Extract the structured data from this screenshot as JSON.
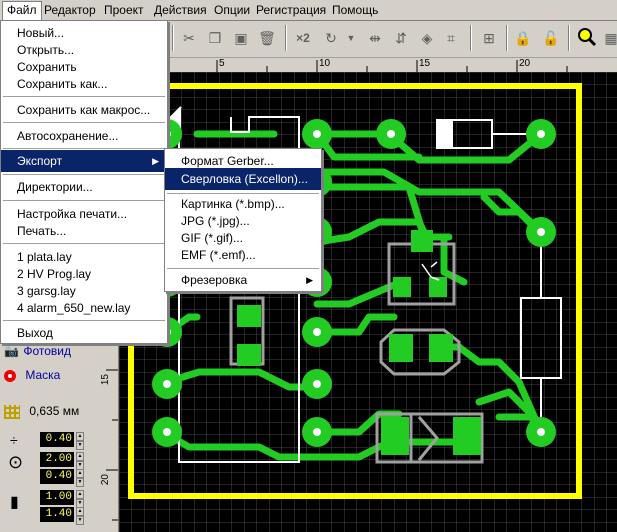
{
  "menubar": {
    "items": [
      {
        "label": "Файл"
      },
      {
        "label": "Редактор"
      },
      {
        "label": "Проект"
      },
      {
        "label": "Действия"
      },
      {
        "label": "Опции"
      },
      {
        "label": "Регистрация"
      },
      {
        "label": "Помощь"
      }
    ]
  },
  "toolbar": {
    "zoom_label": "×2"
  },
  "ruler": {
    "h_labels": [
      "5",
      "10",
      "15",
      "20"
    ],
    "v_labels": [
      "15",
      "20"
    ]
  },
  "file_menu": {
    "items": [
      {
        "label": "Новый..."
      },
      {
        "label": "Открыть..."
      },
      {
        "label": "Сохранить"
      },
      {
        "label": "Сохранить как..."
      },
      {
        "label": "Сохранить как макрос..."
      },
      {
        "label": "Автосохранение..."
      },
      {
        "label": "Экспорт"
      },
      {
        "label": "Директории..."
      },
      {
        "label": "Настройка печати..."
      },
      {
        "label": "Печать..."
      },
      {
        "label": "1 plata.lay"
      },
      {
        "label": "2 HV Prog.lay"
      },
      {
        "label": "3 garsg.lay"
      },
      {
        "label": "4 alarm_650_new.lay"
      },
      {
        "label": "Выход"
      }
    ]
  },
  "export_submenu": {
    "items": [
      {
        "label": "Формат Gerber..."
      },
      {
        "label": "Сверловка (Excellon)..."
      },
      {
        "label": "Картинка (*.bmp)..."
      },
      {
        "label": "JPG (*.jpg)..."
      },
      {
        "label": "GIF (*.gif)..."
      },
      {
        "label": "EMF (*.emf)..."
      },
      {
        "label": "Фрезеровка"
      }
    ]
  },
  "left_panel": {
    "photo_label": "Фотовид",
    "mask_label": "Маска",
    "grid_label": "0,635 мм",
    "values": [
      "0.40",
      "2.00",
      "0.40",
      "1.00",
      "1.40"
    ]
  },
  "colors": {
    "board_outline": "#ffff00",
    "track": "#22cc22",
    "pad": "#22cc22",
    "silkscreen": "#ffffff",
    "grid": "#606060",
    "highlight": "#0a246a"
  }
}
